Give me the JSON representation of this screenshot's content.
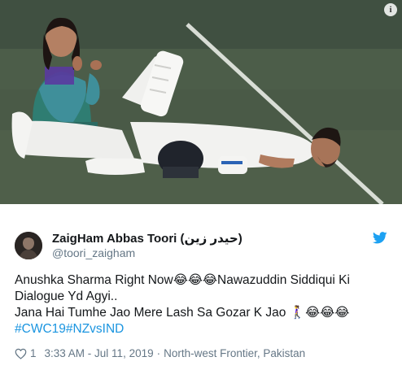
{
  "photo": {
    "description_icon": "info-icon",
    "info_label": "i"
  },
  "tweet": {
    "display_name": "ZaigHam Abbas Toori (حیدر زین)",
    "handle": "@toori_zaigham",
    "brand_icon": "twitter-bird-icon",
    "brand_color": "#1da1f2",
    "text_lines": [
      "Anushka Sharma Right Now😂😂😂Nawazuddin Siddiqui Ki",
      "Dialogue Yd Agyi..",
      "Jana Hai Tumhe Jao Mere Lash Sa Gozar K Jao 🚶‍♀️😂😂😂"
    ],
    "hashtags": "#CWC19#NZvsIND",
    "like_icon": "heart-icon",
    "like_count": "1",
    "timestamp": "3:33 AM - Jul 11, 2019",
    "separator": "·",
    "location": "North-west Frontier, Pakistan",
    "hashtag_color": "#1b95e0",
    "text_color": "#14171a",
    "meta_color": "#657786"
  }
}
